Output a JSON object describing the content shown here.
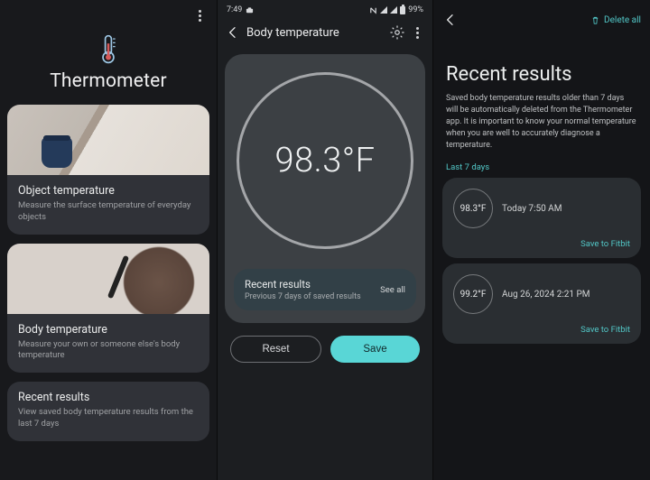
{
  "accent": "#52c7c7",
  "col1": {
    "app_title": "Thermometer",
    "cards": {
      "object": {
        "title": "Object temperature",
        "subtitle": "Measure the surface temperature of everyday objects"
      },
      "body": {
        "title": "Body temperature",
        "subtitle": "Measure your own or someone else's body temperature"
      },
      "recent": {
        "title": "Recent results",
        "subtitle": "View saved body temperature results from the last 7 days"
      }
    }
  },
  "col2": {
    "status": {
      "time": "7:49",
      "battery_pct": "99%"
    },
    "screen_title": "Body temperature",
    "reading": "98.3°F",
    "recent_chip": {
      "title": "Recent results",
      "subtitle": "Previous 7 days of saved results",
      "see_all": "See all"
    },
    "buttons": {
      "reset": "Reset",
      "save": "Save"
    }
  },
  "col3": {
    "delete_all": "Delete all",
    "title": "Recent results",
    "description": "Saved body temperature results older than 7 days will be automatically deleted from the Thermometer app. It is important to know your normal temperature when you are well to accurately diagnose a temperature.",
    "range_label": "Last 7 days",
    "save_label": "Save to Fitbit",
    "results": [
      {
        "value": "98.3°F",
        "time": "Today 7:50 AM"
      },
      {
        "value": "99.2°F",
        "time": "Aug 26, 2024 2:21 PM"
      }
    ]
  }
}
